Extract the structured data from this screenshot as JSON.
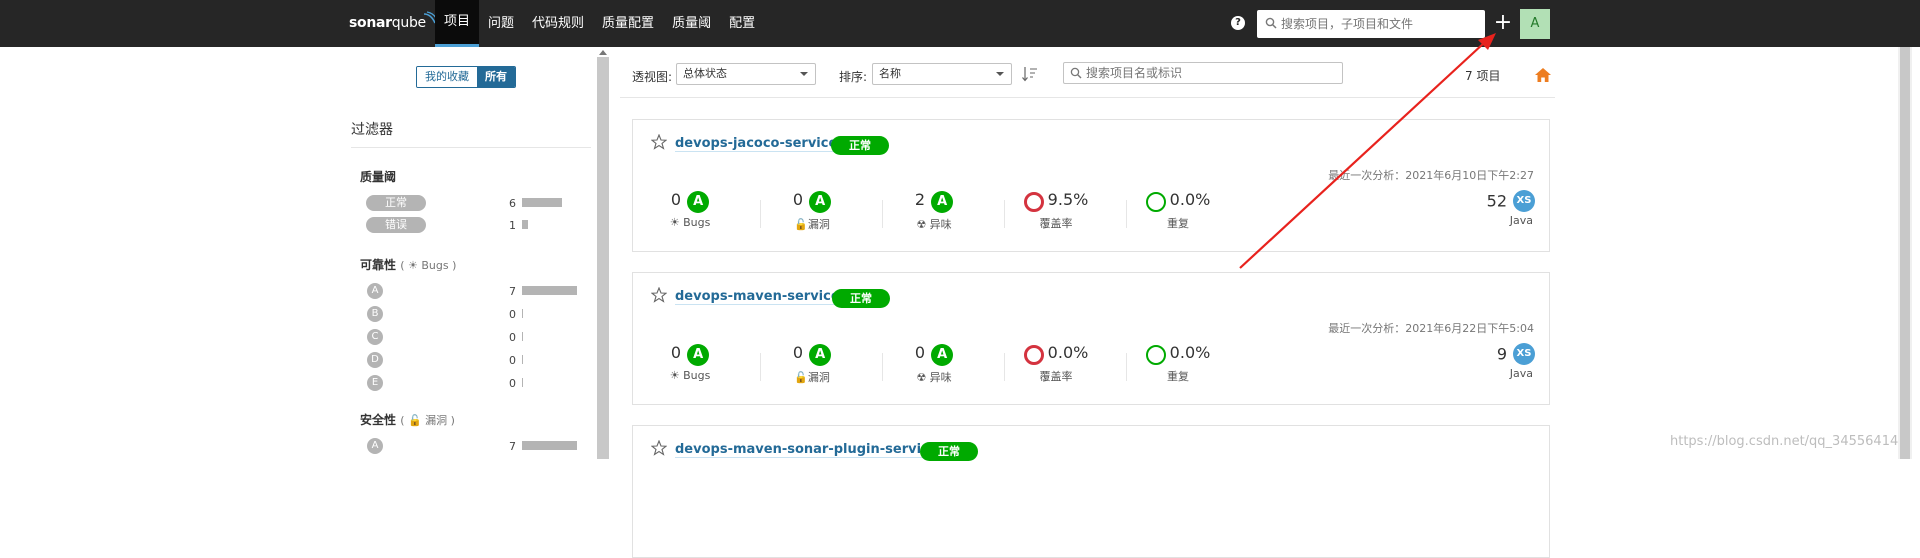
{
  "app": {
    "logo_main": "sonar",
    "logo_accent": "qube"
  },
  "nav": {
    "items": [
      "项目",
      "问题",
      "代码规则",
      "质量配置",
      "质量阈",
      "配置"
    ],
    "active_index": 0
  },
  "header": {
    "search_placeholder": "搜索项目，子项目和文件",
    "help_label": "?",
    "add_label": "+",
    "avatar_letter": "A"
  },
  "sidebar": {
    "toggle": {
      "favorites": "我的收藏",
      "all": "所有",
      "selected": "所有"
    },
    "filters_title": "过滤器",
    "quality_gate": {
      "title": "质量阈",
      "items": [
        {
          "label": "正常",
          "count": "6",
          "fraction": 0.86
        },
        {
          "label": "错误",
          "count": "1",
          "fraction": 0.14
        }
      ]
    },
    "reliability": {
      "title": "可靠性",
      "sub": "( ☀ Bugs )",
      "items": [
        {
          "label": "A",
          "count": "7",
          "fraction": 1
        },
        {
          "label": "B",
          "count": "0",
          "fraction": 0
        },
        {
          "label": "C",
          "count": "0",
          "fraction": 0
        },
        {
          "label": "D",
          "count": "0",
          "fraction": 0
        },
        {
          "label": "E",
          "count": "0",
          "fraction": 0
        }
      ]
    },
    "security": {
      "title": "安全性",
      "sub": "( 🔓 漏洞 )",
      "items": [
        {
          "label": "A",
          "count": "7",
          "fraction": 1
        }
      ]
    }
  },
  "toolbar": {
    "perspective_label": "透视图:",
    "perspective_value": "总体状态",
    "sort_label": "排序:",
    "sort_value": "名称",
    "search_placeholder": "搜索项目名或标识",
    "project_count": "7 项目"
  },
  "projects": [
    {
      "name": "devops-jacoco-service",
      "status": "正常",
      "last_analysis": "最近一次分析：2021年6月10日下午2:27",
      "bugs": {
        "value": "0",
        "rating": "A",
        "label": "Bugs"
      },
      "vulnerabilities": {
        "value": "0",
        "rating": "A",
        "label": "漏洞"
      },
      "code_smells": {
        "value": "2",
        "rating": "A",
        "label": "异味"
      },
      "coverage": {
        "value": "9.5%",
        "label": "覆盖率"
      },
      "duplications": {
        "value": "0.0%",
        "label": "重复"
      },
      "loc": "52",
      "size": "XS",
      "language": "Java"
    },
    {
      "name": "devops-maven-service",
      "status": "正常",
      "last_analysis": "最近一次分析：2021年6月22日下午5:04",
      "bugs": {
        "value": "0",
        "rating": "A",
        "label": "Bugs"
      },
      "vulnerabilities": {
        "value": "0",
        "rating": "A",
        "label": "漏洞"
      },
      "code_smells": {
        "value": "0",
        "rating": "A",
        "label": "异味"
      },
      "coverage": {
        "value": "0.0%",
        "label": "覆盖率"
      },
      "duplications": {
        "value": "0.0%",
        "label": "重复"
      },
      "loc": "9",
      "size": "XS",
      "language": "Java"
    },
    {
      "name": "devops-maven-sonar-plugin-service",
      "status": "正常"
    }
  ],
  "colors": {
    "topbar": "#262626",
    "accent": "#236a97",
    "ok_green": "#00aa00",
    "coverage_red": "#d4333f",
    "dup_green": "#00aa00",
    "size_blue": "#4b9fd5",
    "home_orange": "#ed7d20",
    "annotation_red": "#e8221d"
  },
  "watermark": "https://blog.csdn.net/qq_34556414"
}
